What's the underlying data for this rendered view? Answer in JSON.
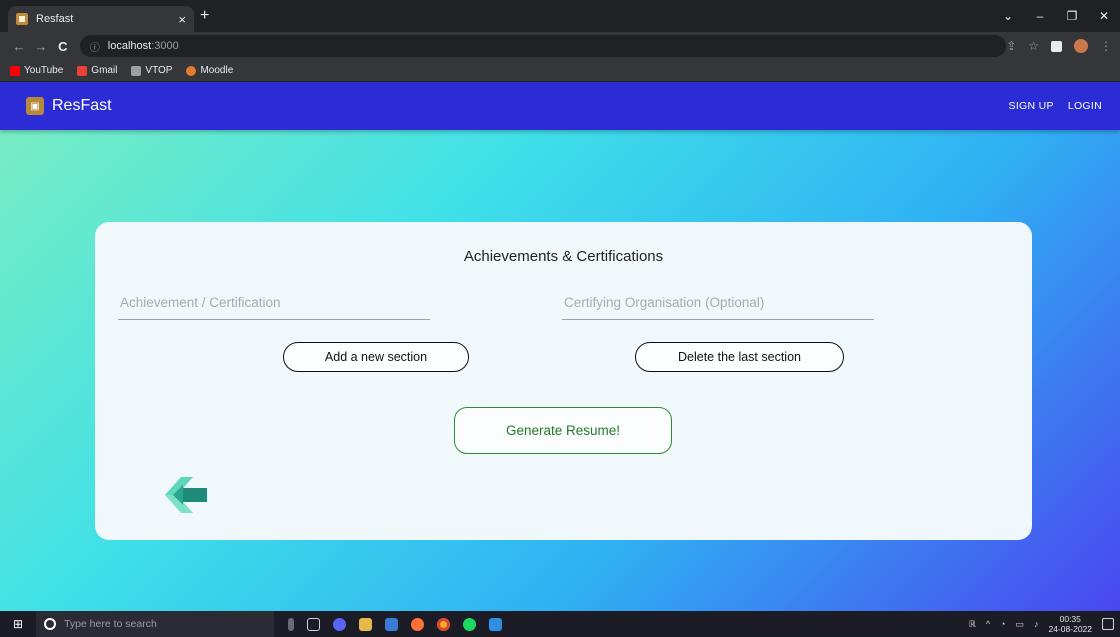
{
  "browser": {
    "tab_title": "Resfast",
    "tab_close": "×",
    "new_tab": "+",
    "window_controls": [
      "⌄",
      "–",
      "❐",
      "✕"
    ],
    "nav": {
      "back": "←",
      "forward": "→",
      "reload": "C"
    },
    "url_host": "localhost",
    "url_port": ":3000",
    "bookmarks": [
      {
        "label": "YouTube",
        "color": "#ff0000"
      },
      {
        "label": "Gmail",
        "color": "#ea4335"
      },
      {
        "label": "VTOP",
        "color": "#9aa0a6"
      },
      {
        "label": "Moodle",
        "color": "#e37a2c"
      }
    ]
  },
  "app": {
    "name": "ResFast",
    "nav": {
      "signup": "SIGN UP",
      "login": "LOGIN"
    },
    "header_color": "#2c2cd6"
  },
  "form": {
    "title": "Achievements & Certifications",
    "achievement_placeholder": "Achievement / Certification",
    "organisation_placeholder": "Certifying Organisation (Optional)",
    "add_section": "Add a new section",
    "delete_section": "Delete the last section",
    "generate": "Generate Resume!"
  },
  "taskbar": {
    "search_placeholder": "Type here to search",
    "time": "00:35",
    "date": "24-08-2022",
    "apps": [
      "mic-icon",
      "task-view-icon",
      "discord-icon",
      "file-explorer-icon",
      "store-icon",
      "firefox-icon",
      "chrome-icon",
      "spotify-icon",
      "vscode-icon"
    ]
  }
}
